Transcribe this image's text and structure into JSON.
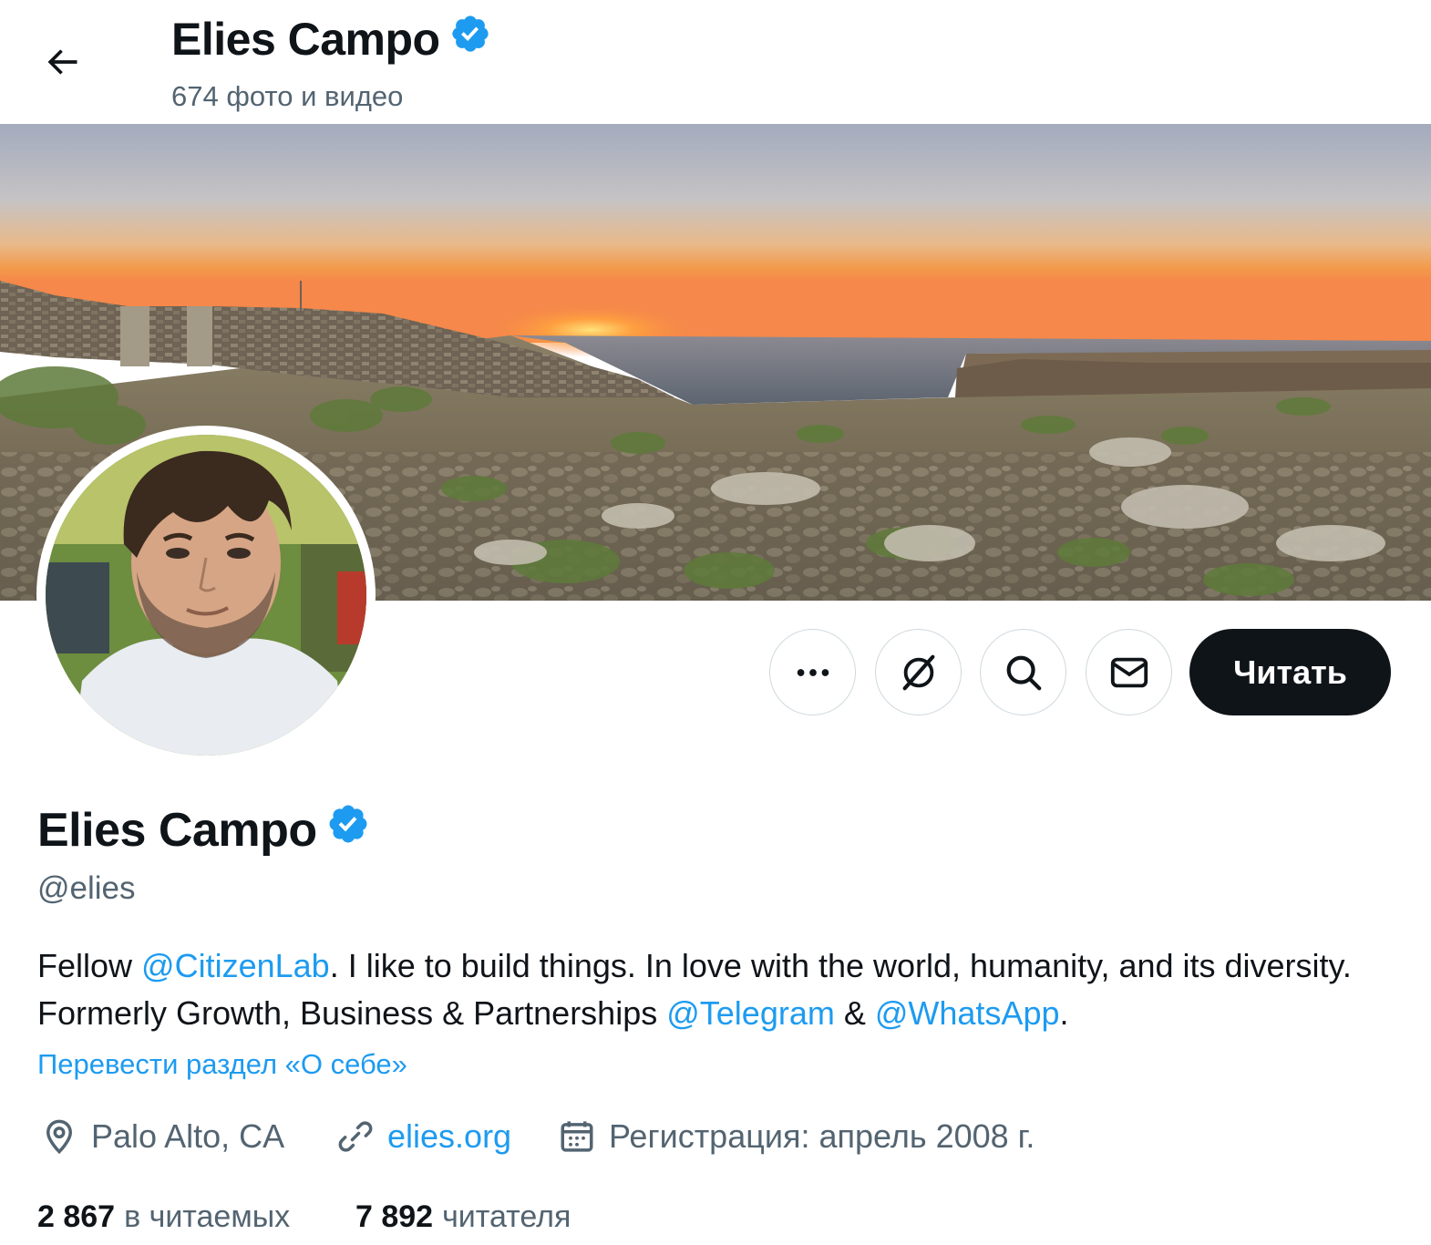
{
  "header": {
    "title": "Elies Campo",
    "subtitle": "674 фото и видео"
  },
  "actions": {
    "follow_label": "Читать"
  },
  "profile": {
    "name": "Elies Campo",
    "handle": "@elies",
    "bio": {
      "t1": "Fellow ",
      "m1": "@CitizenLab",
      "t2": ". I like to build things. In love with the world, humanity, and its diversity. Formerly Growth, Business & Partnerships ",
      "m2": "@Telegram",
      "t3": " & ",
      "m3": "@WhatsApp",
      "t4": "."
    },
    "translate_label": "Перевести раздел «О себе»",
    "location": "Palo Alto, CA",
    "website": "elies.org",
    "joined": "Регистрация: апрель 2008 г.",
    "following_count": "2 867",
    "following_label": "в читаемых",
    "followers_count": "7 892",
    "followers_label": "читателя"
  },
  "colors": {
    "accent": "#1d9bf0",
    "text": "#0f1419",
    "secondary": "#536471",
    "border": "#cfd9de"
  },
  "icons": [
    "back-arrow-icon",
    "verified-badge-icon",
    "more-icon",
    "grok-icon",
    "search-icon",
    "message-icon",
    "location-icon",
    "link-icon",
    "calendar-icon"
  ]
}
